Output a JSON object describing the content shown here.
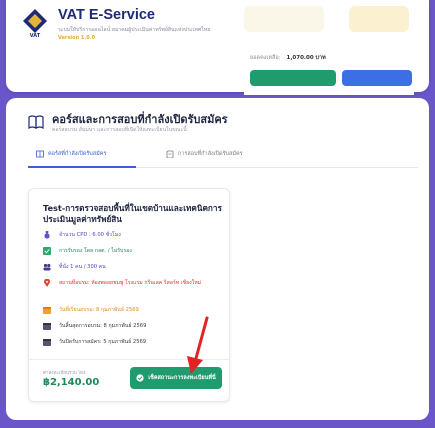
{
  "header": {
    "app_title": "VAT E-Service",
    "app_subtitle": "ระบบให้บริการออนไลน์ สมาคมผู้ประเมินค่าทรัพย์สินแห่งประเทศไทย",
    "version": "Version 1.0.0",
    "balance_label": "ยอดคงเหลือ:",
    "balance_value": "1,070.00 บาท"
  },
  "section": {
    "title": "คอร์สและการสอบที่กำลังเปิดรับสมัคร",
    "subtitle": "คอร์สอบรม สัมมนา และการสอบที่เปิดให้ลงทะเบียนในขณะนี้",
    "tabs": [
      {
        "label": "คอร์สที่กำลังเปิดรับสมัคร",
        "active": true
      },
      {
        "label": "การสอบที่กำลังเปิดรับสมัคร",
        "active": false
      }
    ]
  },
  "course": {
    "title": "Test-การตรวจสอบพื้นที่ในเขตบ้านและเทคนิคการประเมินมูลค่าทรัพย์สิน",
    "cpd": "จำนวน CPD : 6.00 ชั่วโมง",
    "approval": "การรับรอง โดย กลต. / ไม่รับรอง",
    "seats": "ที่นั่ง 1 คน / 300 คน",
    "location": "สถานที่อบรม: ห้องพลอยชมพู โรงแรม กรีนเลค รีสอร์ท เชียงใหม่",
    "training_date": "วันที่เรียนอบรม: 8 กุมภาพันธ์ 2569",
    "end_date": "วันสิ้นสุดการอบรม: 8 กุมภาพันธ์ 2569",
    "close_date": "วันปิดรับการสมัคร: 5 กุมภาพันธ์ 2569",
    "price_label": "ค่าลงทะเบียนรวม Vat",
    "price": "฿2,140.00",
    "apply_label": "เช็คสถานะการลงทะเบียนที่นี่"
  },
  "colors": {
    "background": "#6a56c9",
    "accent_blue": "#3b5fd6",
    "green": "#1f9b6e",
    "red_text": "#d9353a",
    "orange_text": "#e08a1e",
    "purple_text": "#5a3fc0"
  }
}
